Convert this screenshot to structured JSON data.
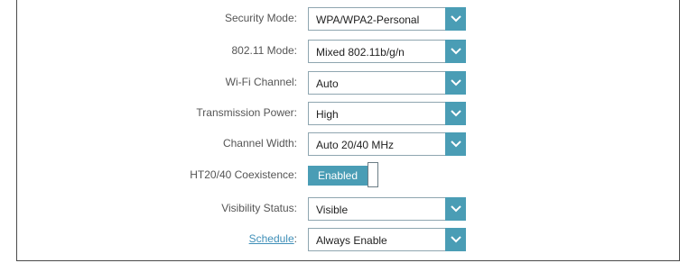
{
  "settings": {
    "security_mode": {
      "label": "Security Mode:",
      "value": "WPA/WPA2-Personal",
      "icon": "chevron-down-icon"
    },
    "mode_80211": {
      "label": "802.11 Mode:",
      "value": "Mixed 802.11b/g/n",
      "icon": "chevron-down-icon"
    },
    "wifi_channel": {
      "label": "Wi-Fi Channel:",
      "value": "Auto",
      "icon": "chevron-down-icon"
    },
    "transmission_power": {
      "label": "Transmission Power:",
      "value": "High",
      "icon": "chevron-down-icon"
    },
    "channel_width": {
      "label": "Channel Width:",
      "value": "Auto 20/40 MHz",
      "icon": "chevron-down-icon"
    },
    "ht_coexistence": {
      "label": "HT20/40 Coexistence:",
      "value": "Enabled"
    },
    "visibility_status": {
      "label": "Visibility Status:",
      "value": "Visible",
      "icon": "chevron-down-icon"
    },
    "schedule": {
      "label": "Schedule",
      "label_suffix": ":",
      "value": "Always Enable",
      "icon": "chevron-down-icon"
    }
  },
  "colors": {
    "accent": "#4a9db5",
    "link": "#3f8fb8",
    "label_text": "#555555",
    "value_text": "#222222",
    "panel_border": "#4a4a4a"
  }
}
